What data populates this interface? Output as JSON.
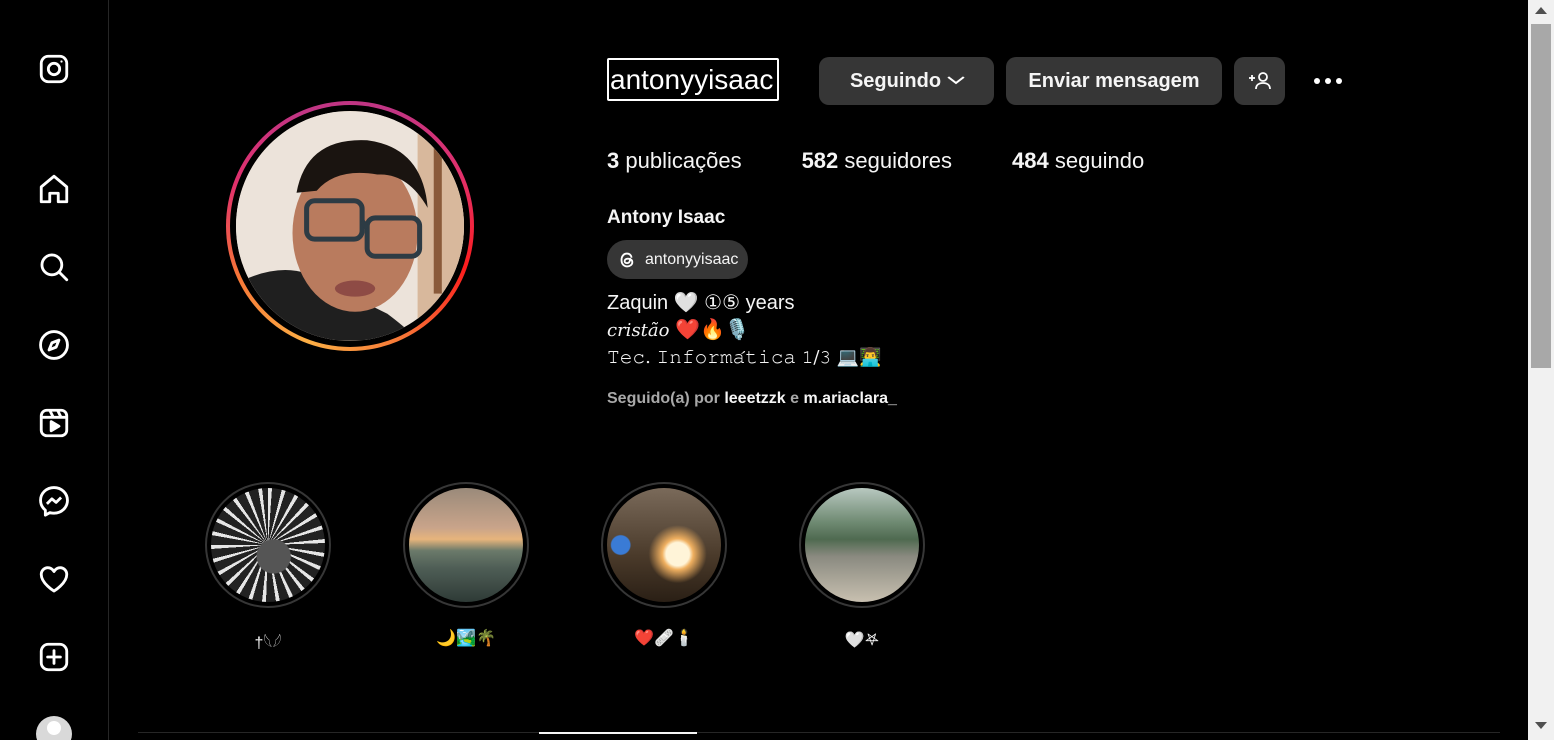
{
  "sidebar": {
    "items": [
      {
        "icon": "instagram-logo-icon"
      },
      {
        "icon": "home-icon"
      },
      {
        "icon": "search-icon"
      },
      {
        "icon": "explore-compass-icon"
      },
      {
        "icon": "reels-icon"
      },
      {
        "icon": "messenger-icon"
      },
      {
        "icon": "heart-icon"
      },
      {
        "icon": "create-plus-icon"
      }
    ]
  },
  "profile": {
    "username": "antonyyisaac",
    "following_button": "Seguindo",
    "message_button": "Enviar mensagem",
    "stats": {
      "posts_count": "3",
      "posts_label": "publicações",
      "followers_count": "582",
      "followers_label": "seguidores",
      "following_count": "484",
      "following_label": "seguindo"
    },
    "full_name": "Antony Isaac",
    "threads_handle": "antonyyisaac",
    "bio_line1": "Zaquin 🤍  ①⑤ years",
    "bio_line2_text": "𝑐𝑟𝑖𝑠𝑡𝑎̃𝑜",
    "bio_line2_emoji": " ❤️🔥🎙️",
    "bio_line3": "𝚃𝚎𝚌. 𝙸𝚗𝚏𝚘𝚛𝚖𝚊́𝚝𝚒𝚌𝚊 𝟷/𝟹 💻👨‍💻",
    "followed_prefix": "Seguido(a) por ",
    "followed_acct1": "leeetzzk",
    "followed_conj": " e ",
    "followed_acct2": "m.ariaclara_"
  },
  "highlights": [
    {
      "label": "†𓆩𓆪"
    },
    {
      "label": "🌙🏞️🌴"
    },
    {
      "label": "❤️🩹🕯️"
    },
    {
      "label": "🤍𖤐"
    }
  ],
  "colors": {
    "background": "#000000",
    "button_bg": "#363636",
    "muted_text": "#a8a8a8",
    "border": "#262626"
  }
}
